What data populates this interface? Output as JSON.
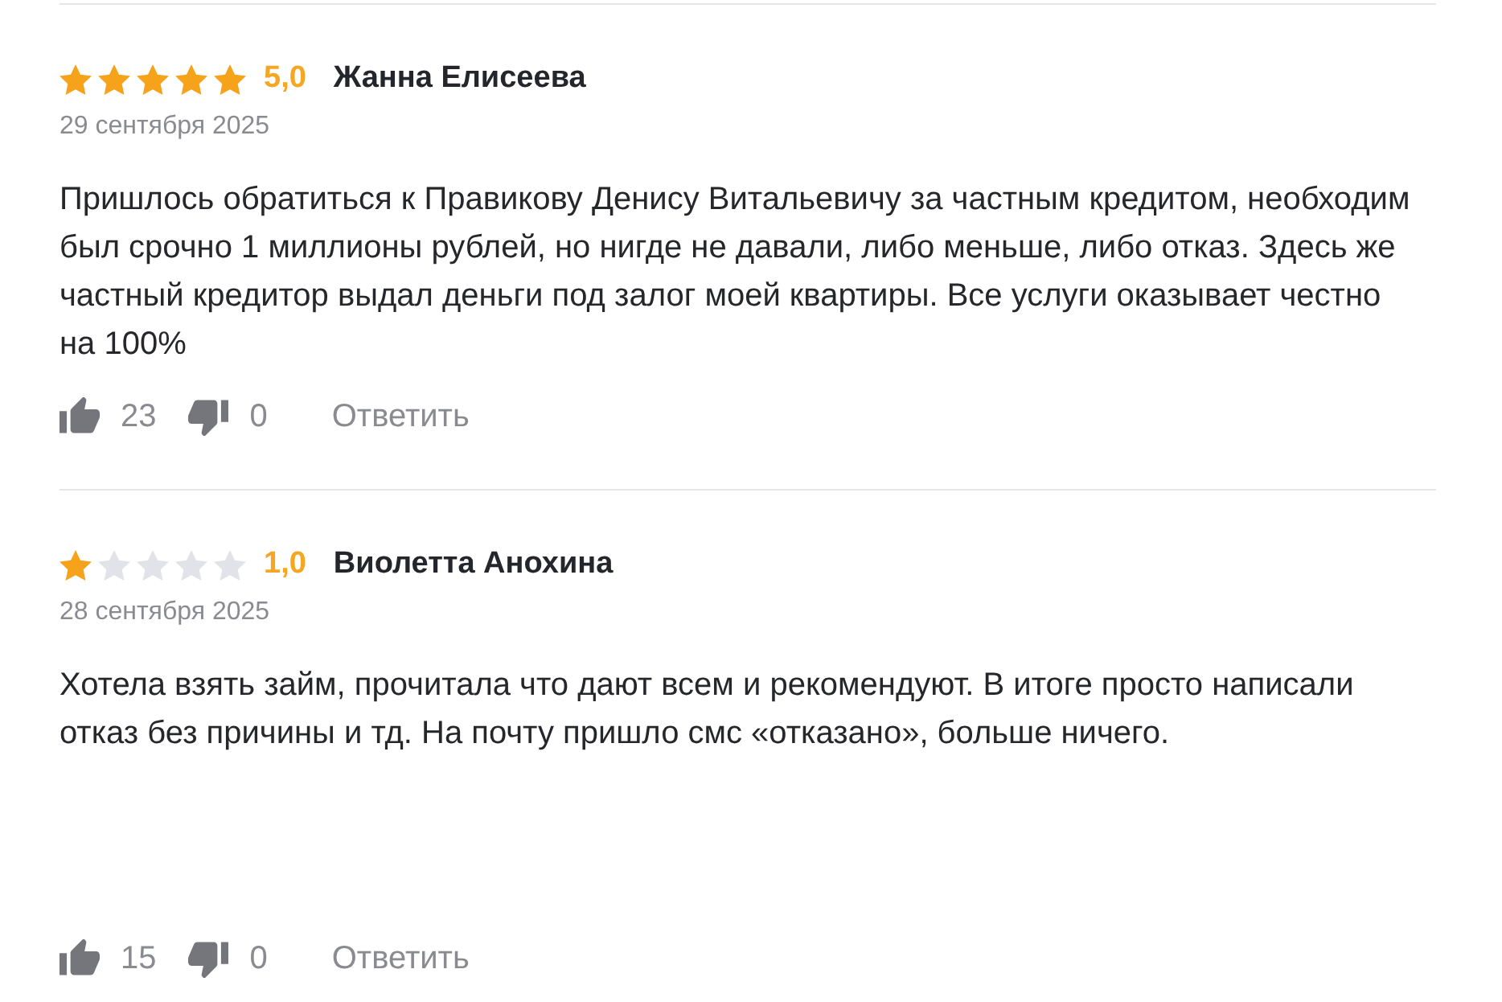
{
  "reviews": [
    {
      "stars": 5,
      "rating": "5,0",
      "author": "Жанна Елисеева",
      "date": "29 сентября 2025",
      "text": "Пришлось обратиться к Правикову Денису Витальевичу за частным кредитом, необходим был срочно 1 миллионы рублей, но нигде не давали, либо меньше, либо отказ. Здесь же частный кредитор выдал деньги под залог моей квартиры. Все услуги оказывает честно на 100%",
      "likes": "23",
      "dislikes": "0",
      "reply": "Ответить"
    },
    {
      "stars": 1,
      "rating": "1,0",
      "author": "Виолетта Анохина",
      "date": "28 сентября 2025",
      "text": "Хотела взять займ, прочитала что дают всем и рекомендуют. В итоге просто написали отказ без причины и тд. На почту пришло смс «отказано», больше ничего.",
      "likes": "15",
      "dislikes": "0",
      "reply": "Ответить"
    }
  ]
}
